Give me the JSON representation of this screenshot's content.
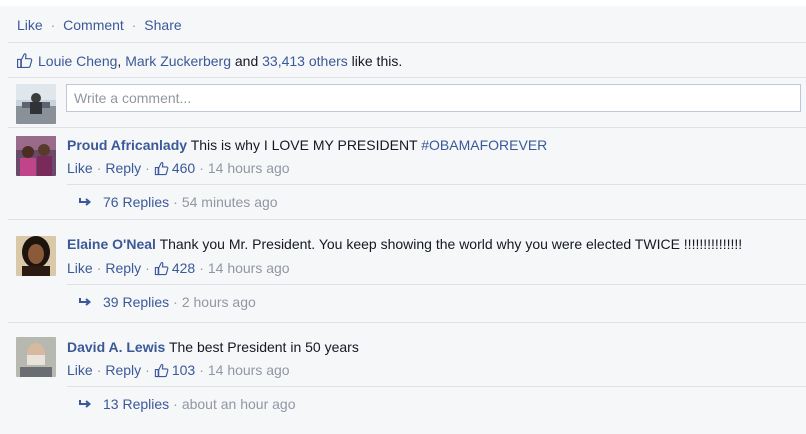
{
  "actions": {
    "like": "Like",
    "comment": "Comment",
    "share": "Share",
    "separator": "·"
  },
  "likes_summary": {
    "name1": "Louie Cheng",
    "comma": ",",
    "name2": "Mark Zuckerberg",
    "and": "and",
    "others": "33,413 others",
    "suffix": "like this."
  },
  "composer": {
    "placeholder": "Write a comment..."
  },
  "comments": [
    {
      "author": "Proud Africanlady",
      "text": "This is why I LOVE MY PRESIDENT",
      "hashtag": "#OBAMAFOREVER",
      "like": "Like",
      "reply": "Reply",
      "like_count": "460",
      "time": "14 hours ago",
      "replies_label": "76 Replies",
      "replies_time": "54 minutes ago"
    },
    {
      "author": "Elaine O'Neal",
      "text": "Thank you Mr. President. You keep showing the world why you were elected TWICE !!!!!!!!!!!!!!!",
      "like": "Like",
      "reply": "Reply",
      "like_count": "428",
      "time": "14 hours ago",
      "replies_label": "39 Replies",
      "replies_time": "2 hours ago"
    },
    {
      "author": "David A. Lewis",
      "text": "The best President in 50 years",
      "like": "Like",
      "reply": "Reply",
      "like_count": "103",
      "time": "14 hours ago",
      "replies_label": "13 Replies",
      "replies_time": "about an hour ago"
    }
  ],
  "colors": {
    "link": "#3b5998",
    "meta": "#9197a3",
    "background": "#f6f7f9",
    "divider": "#dfe1e6"
  }
}
